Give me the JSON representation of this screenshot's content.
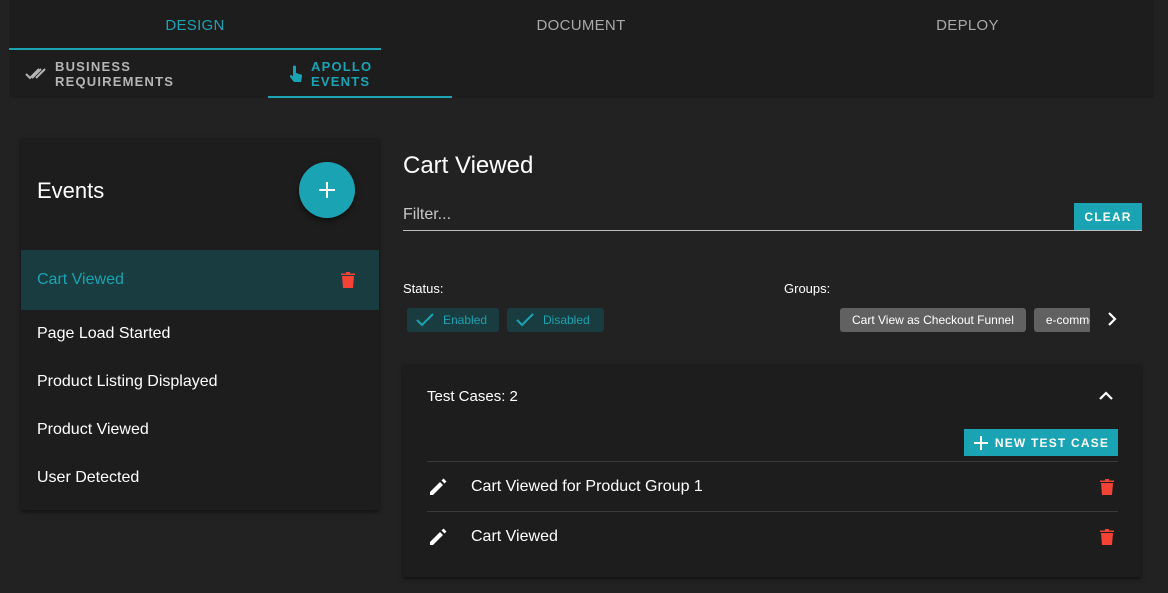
{
  "nav": {
    "main_tabs": [
      {
        "label": "DESIGN",
        "active": true
      },
      {
        "label": "DOCUMENT",
        "active": false
      },
      {
        "label": "DEPLOY",
        "active": false
      }
    ],
    "sub_tabs": [
      {
        "label": "BUSINESS REQUIREMENTS",
        "icon": "double-check-icon",
        "active": false
      },
      {
        "label": "APOLLO EVENTS",
        "icon": "touch-icon",
        "active": true
      }
    ]
  },
  "events_panel": {
    "title": "Events",
    "add_icon": "plus-icon",
    "items": [
      {
        "label": "Cart Viewed",
        "selected": true
      },
      {
        "label": "Page Load Started",
        "selected": false
      },
      {
        "label": "Product Listing Displayed",
        "selected": false
      },
      {
        "label": "Product Viewed",
        "selected": false
      },
      {
        "label": "User Detected",
        "selected": false
      }
    ]
  },
  "detail": {
    "title": "Cart Viewed",
    "filter": {
      "placeholder": "Filter...",
      "value": ""
    },
    "clear_label": "CLEAR",
    "status_label": "Status:",
    "status_chips": [
      {
        "label": "Enabled"
      },
      {
        "label": "Disabled"
      }
    ],
    "groups_label": "Groups:",
    "group_chips": [
      {
        "label": "Cart View as Checkout Funnel"
      },
      {
        "label": "e-commerce"
      }
    ]
  },
  "test_cases": {
    "header": "Test Cases: 2",
    "new_button_label": "NEW TEST CASE",
    "rows": [
      {
        "name": "Cart Viewed for Product Group 1"
      },
      {
        "name": "Cart Viewed"
      }
    ]
  },
  "colors": {
    "accent": "#1aa3b3",
    "selected_bg": "#183c3f",
    "danger": "#f44336",
    "chip_grey": "#616161",
    "surface": "#1d1d1d",
    "background": "#222222"
  }
}
